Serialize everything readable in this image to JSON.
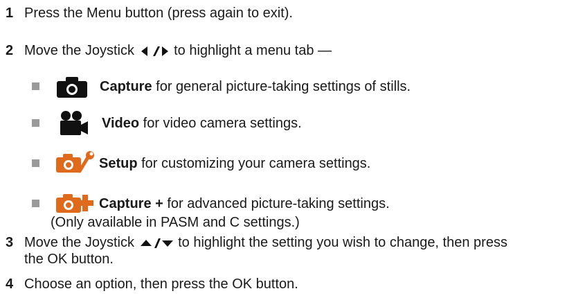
{
  "steps": [
    {
      "num": "1",
      "text": "Press the Menu button (press again to exit)."
    },
    {
      "num": "2",
      "before": "Move the Joystick",
      "after": "to highlight a menu tab —",
      "joystick_icon": "left-right-arrows-icon"
    },
    {
      "num": "3",
      "before": "Move the Joystick",
      "after": "to highlight the setting you wish to change, then press",
      "cont": "the OK button.",
      "joystick_icon": "up-down-arrows-icon"
    },
    {
      "num": "4",
      "text": "Choose an option, then press the OK button."
    }
  ],
  "menu_tabs": [
    {
      "icon": "camera-icon",
      "label": "Capture",
      "desc": "for general picture-taking settings of stills."
    },
    {
      "icon": "video-camera-icon",
      "label": "Video",
      "desc": "for video camera settings."
    },
    {
      "icon": "setup-wrench-icon",
      "label": "Setup",
      "desc": "for customizing your camera settings."
    },
    {
      "icon": "capture-plus-icon",
      "label": "Capture +",
      "desc": "for advanced picture-taking settings.",
      "note": "(Only available in PASM and C settings.)"
    }
  ],
  "colors": {
    "text": "#1a1a1a",
    "bullet": "#9a9a9a",
    "icon_dark": "#111111",
    "icon_light": "#c8c8c8",
    "accent": "#e06a1b"
  }
}
